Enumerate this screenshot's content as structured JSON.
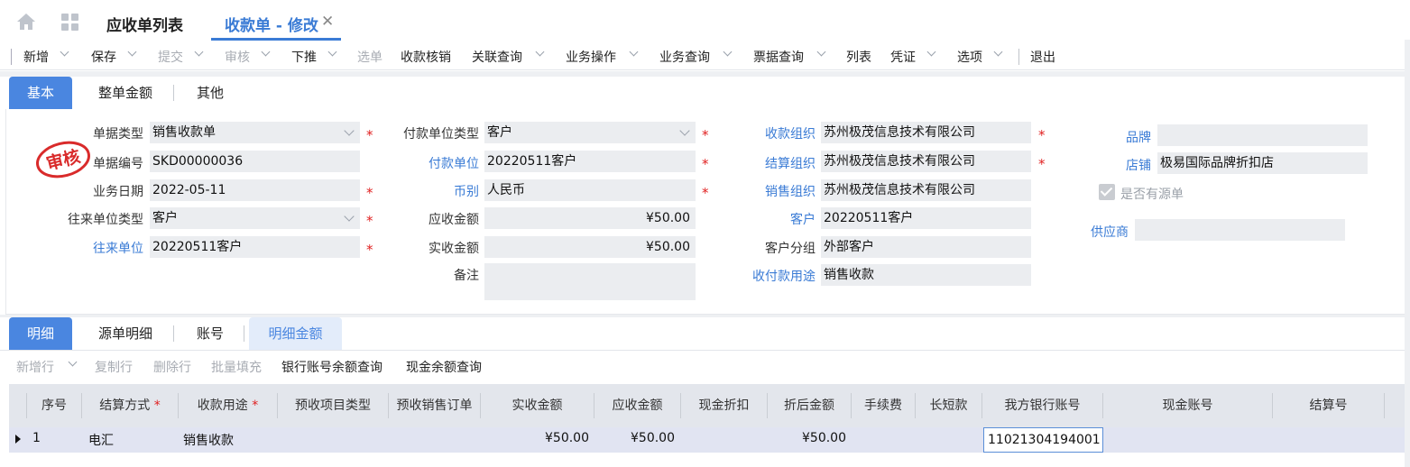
{
  "top_tabs": [
    {
      "label": "应收单列表"
    },
    {
      "label": "收款单 - 修改"
    }
  ],
  "toolbar": {
    "items": [
      {
        "label": "新增",
        "disabled": false,
        "dropdown": true
      },
      {
        "label": "保存",
        "disabled": false,
        "dropdown": true
      },
      {
        "label": "提交",
        "disabled": true,
        "dropdown": true
      },
      {
        "label": "审核",
        "disabled": true,
        "dropdown": true
      },
      {
        "label": "下推",
        "disabled": false,
        "dropdown": true
      },
      {
        "label": "选单",
        "disabled": true,
        "dropdown": false
      },
      {
        "label": "收款核销",
        "disabled": false,
        "dropdown": false
      },
      {
        "label": "关联查询",
        "disabled": false,
        "dropdown": true
      },
      {
        "label": "业务操作",
        "disabled": false,
        "dropdown": true
      },
      {
        "label": "业务查询",
        "disabled": false,
        "dropdown": true
      },
      {
        "label": "票据查询",
        "disabled": false,
        "dropdown": true
      },
      {
        "label": "列表",
        "disabled": false,
        "dropdown": false
      },
      {
        "label": "凭证",
        "disabled": false,
        "dropdown": true
      },
      {
        "label": "选项",
        "disabled": false,
        "dropdown": true
      },
      {
        "label": "退出",
        "disabled": false,
        "dropdown": false
      }
    ]
  },
  "header_tabs": [
    "基本",
    "整单金额",
    "其他"
  ],
  "form": {
    "stamp_text": "审核",
    "col1": {
      "doc_type_label": "单据类型",
      "doc_type_value": "销售收款单",
      "doc_no_label": "单据编号",
      "doc_no_value": "SKD00000036",
      "biz_date_label": "业务日期",
      "biz_date_value": "2022-05-11",
      "partner_type_label": "往来单位类型",
      "partner_type_value": "客户",
      "partner_label": "往来单位",
      "partner_value": "20220511客户"
    },
    "col2": {
      "payer_type_label": "付款单位类型",
      "payer_type_value": "客户",
      "payer_label": "付款单位",
      "payer_value": "20220511客户",
      "currency_label": "币别",
      "currency_value": "人民币",
      "receivable_label": "应收金额",
      "receivable_value": "¥50.00",
      "received_label": "实收金额",
      "received_value": "¥50.00",
      "remark_label": "备注",
      "remark_value": ""
    },
    "col3": {
      "recv_org_label": "收款组织",
      "recv_org_value": "苏州极茂信息技术有限公司",
      "settle_org_label": "结算组织",
      "settle_org_value": "苏州极茂信息技术有限公司",
      "sales_org_label": "销售组织",
      "sales_org_value": "苏州极茂信息技术有限公司",
      "customer_label": "客户",
      "customer_value": "20220511客户",
      "customer_group_label": "客户分组",
      "customer_group_value": "外部客户",
      "purpose_label": "收付款用途",
      "purpose_value": "销售收款"
    },
    "col4": {
      "brand_label": "品牌",
      "brand_value": "",
      "store_label": "店铺",
      "store_value": "极易国际品牌折扣店",
      "has_source_label": "是否有源单",
      "has_source_checked": true,
      "supplier_label": "供应商",
      "supplier_value": ""
    }
  },
  "detail_tabs": [
    "明细",
    "源单明细",
    "账号",
    "明细金额"
  ],
  "detail_toolbar": [
    {
      "label": "新增行",
      "disabled": true
    },
    {
      "label": "复制行",
      "disabled": true
    },
    {
      "label": "删除行",
      "disabled": true
    },
    {
      "label": "批量填充",
      "disabled": true
    },
    {
      "label": "银行账号余额查询",
      "disabled": false
    },
    {
      "label": "现金余额查询",
      "disabled": false
    }
  ],
  "grid": {
    "columns": [
      "序号",
      "结算方式",
      "收款用途",
      "预收项目类型",
      "预收销售订单",
      "实收金额",
      "应收金额",
      "现金折扣",
      "折后金额",
      "手续费",
      "长短款",
      "我方银行账号",
      "现金账号",
      "结算号"
    ],
    "required_marker": "*",
    "rows": [
      {
        "seq": "1",
        "settle_method": "电汇",
        "purpose": "销售收款",
        "prepay_type": "",
        "prepay_order": "",
        "received": "¥50.00",
        "receivable": "¥50.00",
        "cash_discount": "",
        "after_discount": "¥50.00",
        "fee": "",
        "over_short": "",
        "bank_account": "11021304194001",
        "cash_account": "",
        "settle_no": ""
      }
    ]
  },
  "colors": {
    "accent": "#3a7bd5",
    "tab_active_bg": "#4a86e0",
    "required": "#e02020"
  }
}
